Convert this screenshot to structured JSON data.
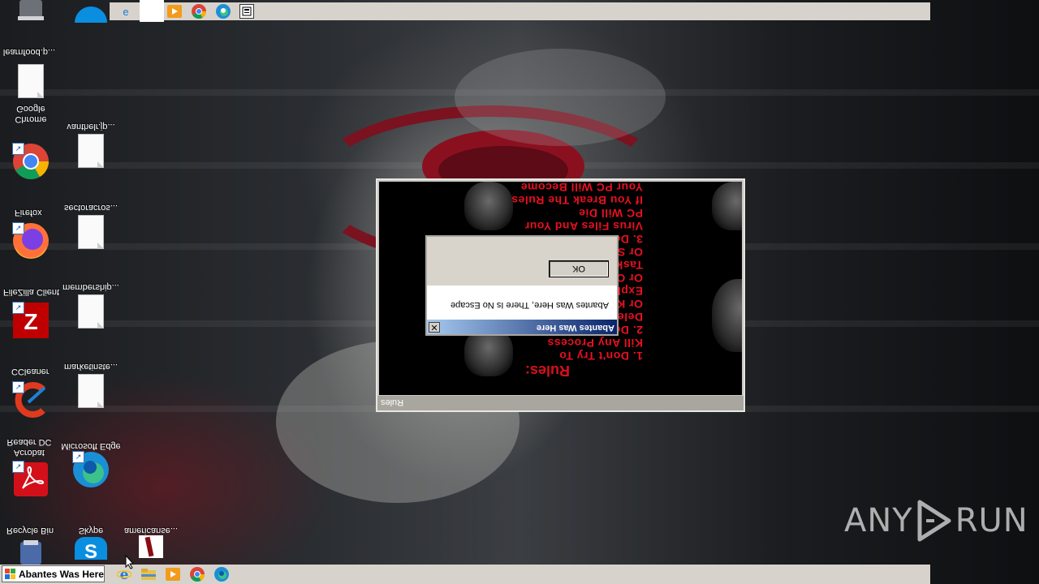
{
  "desktop": {
    "icons": [
      {
        "label": "learnfood.p...",
        "kind": "recycle"
      },
      {
        "label": "Chrome\nGoogle",
        "kind": "doc"
      },
      {
        "label": "vanthelr.jp...",
        "kind": "chrome"
      },
      {
        "label": "Firefox",
        "kind": "doc"
      },
      {
        "label": "sectoracros...",
        "kind": "firefox"
      },
      {
        "label": "FileZilla Client",
        "kind": "doc"
      },
      {
        "label": "membership...",
        "kind": "filezilla"
      },
      {
        "label": "CCleaner",
        "kind": "doc"
      },
      {
        "label": "marketinste...",
        "kind": "ccleaner"
      },
      {
        "label": "Acrobat\nReader DC",
        "kind": "doc"
      },
      {
        "label": "Microsoft Edge",
        "kind": "acrobat"
      },
      {
        "label": "Recycle Bin",
        "kind": "edge"
      },
      {
        "label": "Skype",
        "kind": "skype"
      },
      {
        "label": "americanse...",
        "kind": "blood-doc"
      }
    ]
  },
  "top_taskbar": {
    "apps": [
      "internet-explorer-icon",
      "file-explorer-icon",
      "media-player-icon",
      "chrome-icon",
      "edge-icon",
      "program-icon"
    ]
  },
  "taskbar": {
    "start_label": "Abantes Was Here",
    "apps": [
      "internet-explorer-icon",
      "file-explorer-icon",
      "media-player-icon",
      "chrome-icon",
      "edge-icon"
    ]
  },
  "rules_window": {
    "title": "Rules",
    "heading": "Rules:",
    "lines": [
      "1. Don't Try To",
      "Kill Any Process",
      "2. Don't Try To",
      "Delete Files",
      "Or Kill",
      "Explorer.EXE",
      "Or Open",
      "Task Manager",
      "Or Shut PC",
      "3. Don't Delete",
      "Virus Files And Your",
      "PC Will Die",
      "If You Break The Rules",
      "Your PC Will Become"
    ]
  },
  "message_box": {
    "title": "Abantes Was Here",
    "message": "Abantes Was Here, There Is No Escape",
    "ok_label": "OK",
    "close_glyph": "✕"
  },
  "watermark": {
    "left": "ANY",
    "right": "RUN"
  }
}
